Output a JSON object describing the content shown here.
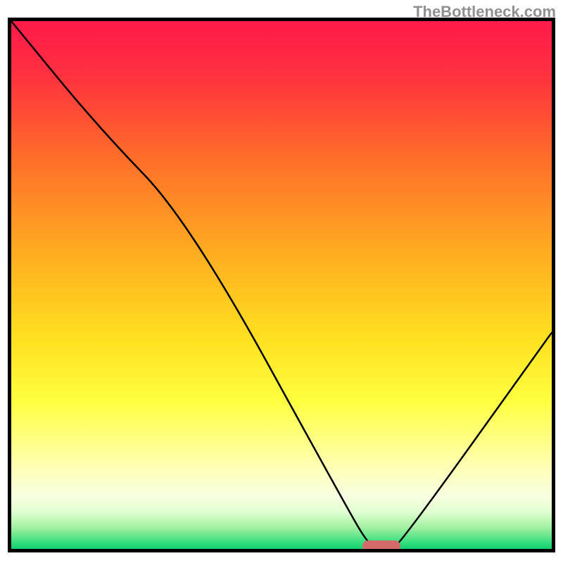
{
  "watermark": "TheBottleneck.com",
  "chart_data": {
    "type": "line",
    "title": "",
    "xlabel": "",
    "ylabel": "",
    "xlim": [
      0,
      100
    ],
    "ylim": [
      0,
      100
    ],
    "grid": false,
    "legend": false,
    "series": [
      {
        "name": "bottleneck-curve",
        "x": [
          0,
          16,
          33,
          62,
          66,
          68,
          70,
          72,
          100
        ],
        "y": [
          100,
          80,
          62,
          8,
          1,
          0,
          0,
          1,
          41
        ]
      }
    ],
    "gradient_stops": [
      {
        "pct": 0,
        "color": "#ff1a4a"
      },
      {
        "pct": 10,
        "color": "#ff3040"
      },
      {
        "pct": 25,
        "color": "#ff6a2a"
      },
      {
        "pct": 45,
        "color": "#ffb020"
      },
      {
        "pct": 60,
        "color": "#ffe020"
      },
      {
        "pct": 72,
        "color": "#ffff40"
      },
      {
        "pct": 84,
        "color": "#ffffb0"
      },
      {
        "pct": 90,
        "color": "#f8ffe0"
      },
      {
        "pct": 93,
        "color": "#e0ffd0"
      },
      {
        "pct": 96,
        "color": "#a0f0a0"
      },
      {
        "pct": 98.5,
        "color": "#40e080"
      },
      {
        "pct": 100,
        "color": "#10d070"
      }
    ],
    "marker": {
      "x_start": 65,
      "x_end": 72,
      "y": 0,
      "color": "#d56a6a"
    }
  }
}
